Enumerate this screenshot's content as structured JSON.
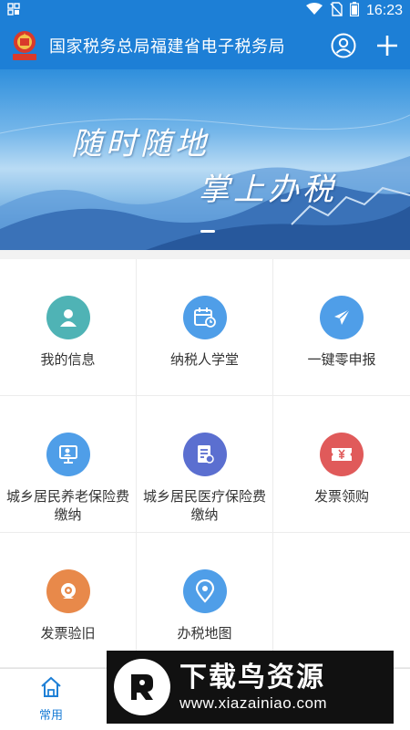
{
  "status_bar": {
    "time": "16:23",
    "left_icon": "notification-grid-icon",
    "icons": [
      "wifi-icon",
      "no-sim-icon",
      "battery-icon"
    ]
  },
  "app_bar": {
    "title": "国家税务总局福建省电子税务局",
    "logo": "tax-emblem-logo",
    "actions": [
      "user-account-icon",
      "add-icon"
    ]
  },
  "banner": {
    "line1": "随时随地",
    "line2": "掌上办税",
    "indicator_count": 1,
    "active_index": 0
  },
  "services": [
    {
      "label": "我的信息",
      "icon": "person-icon",
      "color": "#4fb3b5"
    },
    {
      "label": "纳税人学堂",
      "icon": "calendar-clock-icon",
      "color": "#4f9ee8"
    },
    {
      "label": "一键零申报",
      "icon": "paper-plane-icon",
      "color": "#4f9ee8"
    },
    {
      "label": "城乡居民养老保险费缴纳",
      "icon": "monitor-person-icon",
      "color": "#4f9ee8"
    },
    {
      "label": "城乡居民医疗保险费缴纳",
      "icon": "document-edit-icon",
      "color": "#5b6fd0"
    },
    {
      "label": "发票领购",
      "icon": "yen-ticket-icon",
      "color": "#e05a5a"
    },
    {
      "label": "发票验旧",
      "icon": "camera-icon",
      "color": "#e8894a"
    },
    {
      "label": "办税地图",
      "icon": "map-pin-icon",
      "color": "#4f9ee8"
    }
  ],
  "bottom_nav": {
    "home_label": "常用",
    "home_icon": "home-icon",
    "active_color": "#1d7fd6"
  },
  "watermark": {
    "title": "下载鸟资源",
    "url": "www.xiazainiao.com"
  },
  "colors": {
    "primary": "#1d7fd6",
    "text": "#333333"
  }
}
